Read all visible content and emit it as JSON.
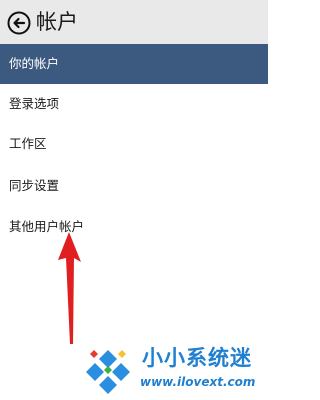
{
  "header": {
    "title": "帐户",
    "back_icon": "back-arrow-circle-icon"
  },
  "nav": {
    "items": [
      {
        "label": "你的帐户",
        "active": true
      },
      {
        "label": "登录选项",
        "active": false
      },
      {
        "label": "工作区",
        "active": false
      },
      {
        "label": "同步设置",
        "active": false
      },
      {
        "label": "其他用户帐户",
        "active": false
      }
    ]
  },
  "annotation": {
    "arrow_icon": "red-pointer-arrow-icon",
    "color": "#e02020"
  },
  "watermark": {
    "name": "小小系统迷",
    "url": "www.ilovext.com",
    "color": "#1f7fd1"
  },
  "colors": {
    "active_background": "#3c5a7f",
    "header_background": "#e9e9e9"
  }
}
